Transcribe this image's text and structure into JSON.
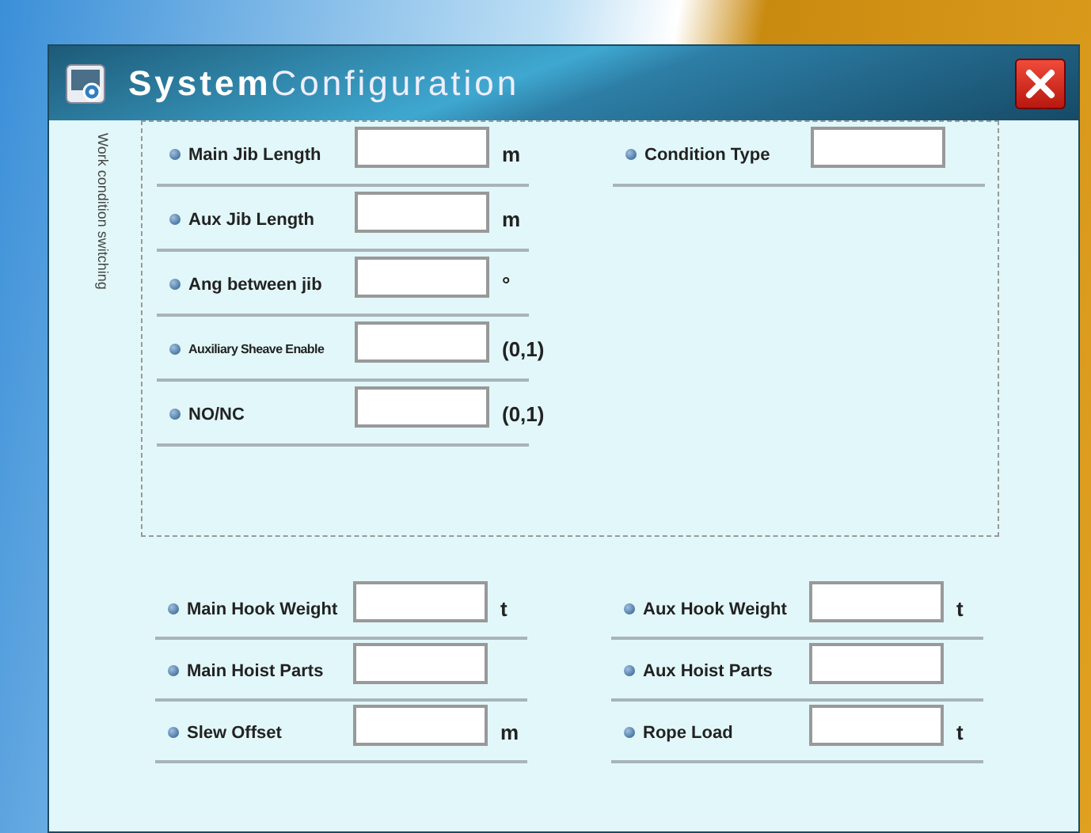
{
  "window": {
    "title_bold": "System",
    "title_rest": "Configuration"
  },
  "work_condition": {
    "label": "Work condition switching",
    "left_fields": [
      {
        "label": "Main Jib Length",
        "unit": "m",
        "kind": "normal"
      },
      {
        "label": "Aux Jib Length",
        "unit": "m",
        "kind": "normal"
      },
      {
        "label": "Ang between jib",
        "unit": "°",
        "kind": "normal"
      },
      {
        "label": "Auxiliary Sheave Enable",
        "unit": "(0,1)",
        "kind": "compact"
      },
      {
        "label": "NO/NC",
        "unit": "(0,1)",
        "kind": "normal"
      }
    ],
    "right_fields": [
      {
        "label": "Condition Type",
        "kind": "normal"
      }
    ]
  },
  "hook_settings": {
    "left_fields": [
      {
        "label": "Main Hook Weight",
        "unit": "t",
        "kind": "normal"
      },
      {
        "label": "Main Hoist Parts",
        "kind": "normal"
      },
      {
        "label": "Slew Offset",
        "unit": "m",
        "kind": "normal"
      }
    ],
    "right_fields": [
      {
        "label": "Aux Hook Weight",
        "unit": "t",
        "kind": "normal"
      },
      {
        "label": "Aux Hoist Parts",
        "kind": "normal"
      },
      {
        "label": "Rope Load",
        "unit": "t",
        "kind": "normal"
      }
    ]
  }
}
